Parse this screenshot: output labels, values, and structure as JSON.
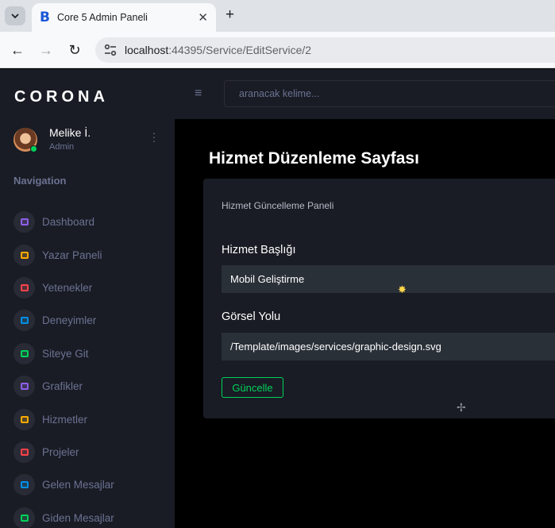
{
  "browser": {
    "tab_title": "Core 5 Admin Paneli",
    "favicon_letter": "B",
    "url_host": "localhost",
    "url_path": ":44395/Service/EditService/2"
  },
  "sidebar": {
    "brand": "CORONA",
    "profile": {
      "name": "Melike İ.",
      "role": "Admin"
    },
    "nav_title": "Navigation",
    "items": [
      {
        "label": "Dashboard",
        "icon": "speedometer-icon",
        "color": "#8f5fe8"
      },
      {
        "label": "Yazar Paneli",
        "icon": "playlist-icon",
        "color": "#ffab00"
      },
      {
        "label": "Yetenekler",
        "icon": "laptop-icon",
        "color": "#fc424a"
      },
      {
        "label": "Deneyimler",
        "icon": "list-icon",
        "color": "#0090e7"
      },
      {
        "label": "Siteye Git",
        "icon": "table-icon",
        "color": "#00d25b"
      },
      {
        "label": "Grafikler",
        "icon": "chart-icon",
        "color": "#8f5fe8"
      },
      {
        "label": "Hizmetler",
        "icon": "contacts-icon",
        "color": "#ffab00"
      },
      {
        "label": "Projeler",
        "icon": "github-icon",
        "color": "#fc424a"
      },
      {
        "label": "Gelen Mesajlar",
        "icon": "message-icon",
        "color": "#0090e7"
      },
      {
        "label": "Giden Mesajlar",
        "icon": "message-outgoing-icon",
        "color": "#00d25b"
      }
    ]
  },
  "topbar": {
    "search_placeholder": "aranacak kelime..."
  },
  "main": {
    "page_title": "Hizmet Düzenleme Sayfası",
    "card_description": "Hizmet Güncelleme Paneli",
    "fields": [
      {
        "label": "Hizmet Başlığı",
        "value": "Mobil Geliştirme"
      },
      {
        "label": "Görsel Yolu",
        "value": "/Template/images/services/graphic-design.svg"
      }
    ],
    "submit_label": "Güncelle"
  }
}
